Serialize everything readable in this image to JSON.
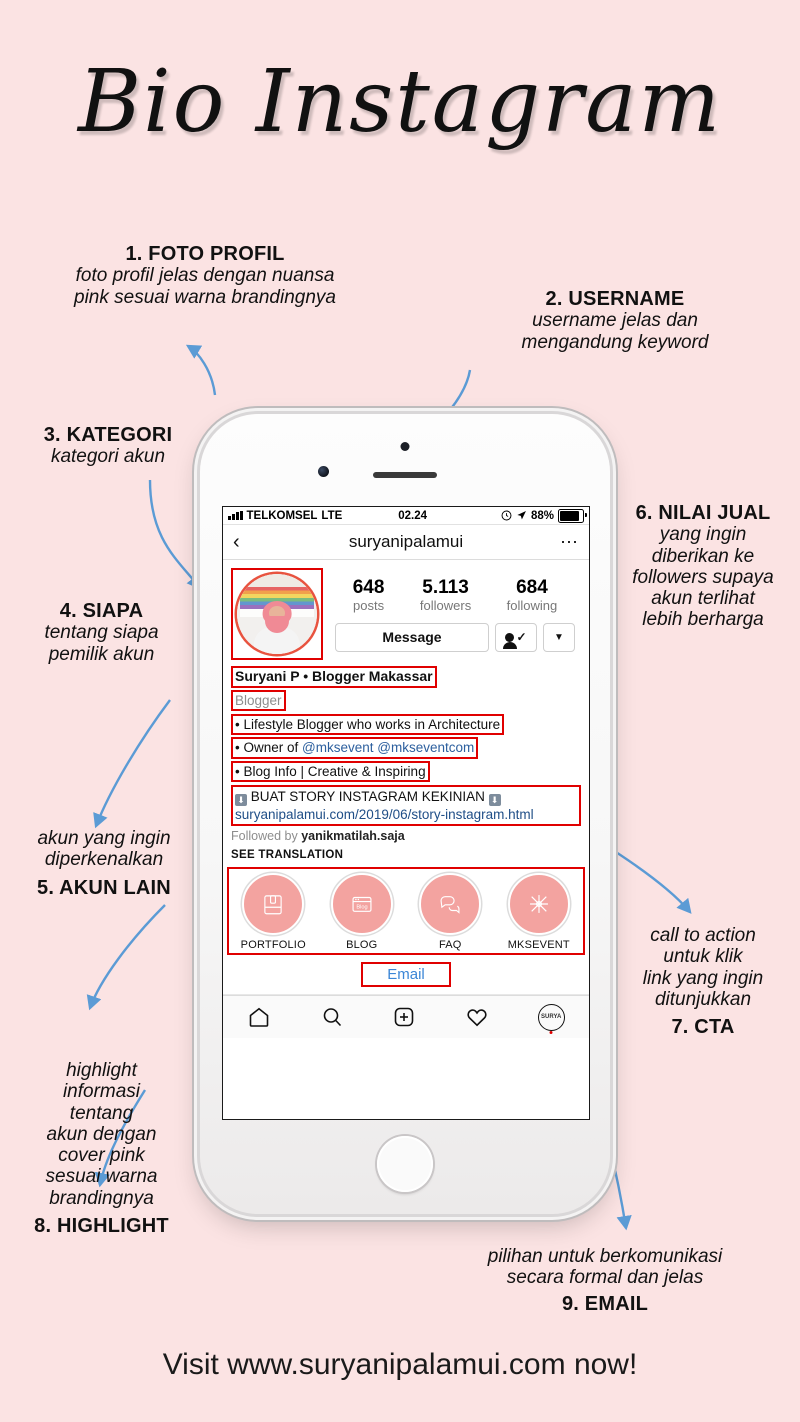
{
  "page": {
    "title": "Bio Instagram",
    "footer": "Visit www.suryanipalamui.com now!",
    "background_color": "#fbe3e3",
    "accent_color": "#e00000",
    "arrow_color": "#5b9bd5"
  },
  "annotations": [
    {
      "id": 1,
      "heading": "1. FOTO PROFIL",
      "body_lines": [
        "foto profil jelas dengan nuansa",
        "pink sesuai warna brandingnya"
      ],
      "heading_position": "top"
    },
    {
      "id": 2,
      "heading": "2. USERNAME",
      "body_lines": [
        "username jelas dan",
        "mengandung keyword"
      ],
      "heading_position": "top"
    },
    {
      "id": 3,
      "heading": "3. KATEGORI",
      "body_lines": [
        "kategori akun"
      ],
      "heading_position": "top"
    },
    {
      "id": 4,
      "heading": "4. SIAPA",
      "body_lines": [
        "tentang siapa",
        "pemilik akun"
      ],
      "heading_position": "top"
    },
    {
      "id": 5,
      "heading": "5. AKUN LAIN",
      "body_lines": [
        "akun yang ingin",
        "diperkenalkan"
      ],
      "heading_position": "bottom"
    },
    {
      "id": 6,
      "heading": "6. NILAI JUAL",
      "body_lines": [
        "yang ingin",
        "diberikan ke",
        "followers supaya",
        "akun terlihat",
        "lebih berharga"
      ],
      "heading_position": "top"
    },
    {
      "id": 7,
      "heading": "7. CTA",
      "body_lines": [
        "call to action",
        "untuk klik",
        "link yang ingin",
        "ditunjukkan"
      ],
      "heading_position": "bottom"
    },
    {
      "id": 8,
      "heading": "8. HIGHLIGHT",
      "body_lines": [
        "highlight",
        "informasi",
        "tentang",
        "akun dengan",
        "cover pink",
        "sesuai warna",
        "brandingnya"
      ],
      "heading_position": "bottom"
    },
    {
      "id": 9,
      "heading": "9. EMAIL",
      "body_lines": [
        "pilihan untuk berkomunikasi",
        "secara formal dan jelas"
      ],
      "heading_position": "bottom"
    }
  ],
  "phone": {
    "status_bar": {
      "carrier": "TELKOMSEL",
      "network": "LTE",
      "time": "02.24",
      "battery_percent": "88%",
      "signal_icon": "signal-bars-icon",
      "alarm_icon": "alarm-icon",
      "location_icon": "location-arrow-icon",
      "battery_icon": "battery-icon"
    },
    "nav_bar": {
      "back_icon": "chevron-left-icon",
      "username": "suryanipalamui",
      "more_icon": "more-options-icon"
    },
    "profile": {
      "avatar_name": "profile-photo",
      "stats": [
        {
          "value": "648",
          "label": "posts"
        },
        {
          "value": "5.113",
          "label": "followers"
        },
        {
          "value": "684",
          "label": "following"
        }
      ],
      "buttons": {
        "message": "Message",
        "following_icon": "person-check-icon",
        "dropdown_icon": "chevron-down-icon"
      },
      "display_name": "Suryani P • Blogger Makassar",
      "category": "Blogger",
      "bio_lines": [
        "• Lifestyle Blogger who works in Architecture",
        "• Owner of @mksevent @mkseventcom",
        "• Blog Info | Creative & Inspiring"
      ],
      "bio_mentions": [
        "@mksevent",
        "@mkseventcom"
      ],
      "cta_line": "BUAT STORY INSTAGRAM KEKINIAN",
      "cta_icon": "arrow-down-box-icon",
      "link": "suryanipalamui.com/2019/06/story-instagram.html",
      "followed_by_prefix": "Followed by",
      "followed_by_user": "yanikmatilah.saja",
      "see_translation": "SEE TRANSLATION",
      "email_button": "Email"
    },
    "highlights": [
      {
        "label": "PORTFOLIO",
        "icon": "portfolio-folder-icon"
      },
      {
        "label": "BLOG",
        "icon": "blog-window-icon"
      },
      {
        "label": "FAQ",
        "icon": "chat-bubbles-icon"
      },
      {
        "label": "MKSEVENT",
        "icon": "sparkle-icon"
      }
    ],
    "tab_bar": [
      {
        "name": "home",
        "icon": "home-icon"
      },
      {
        "name": "search",
        "icon": "search-icon"
      },
      {
        "name": "new-post",
        "icon": "plus-square-icon"
      },
      {
        "name": "activity",
        "icon": "heart-icon"
      },
      {
        "name": "profile",
        "icon": "profile-avatar-icon",
        "label": "SURYA"
      }
    ]
  }
}
